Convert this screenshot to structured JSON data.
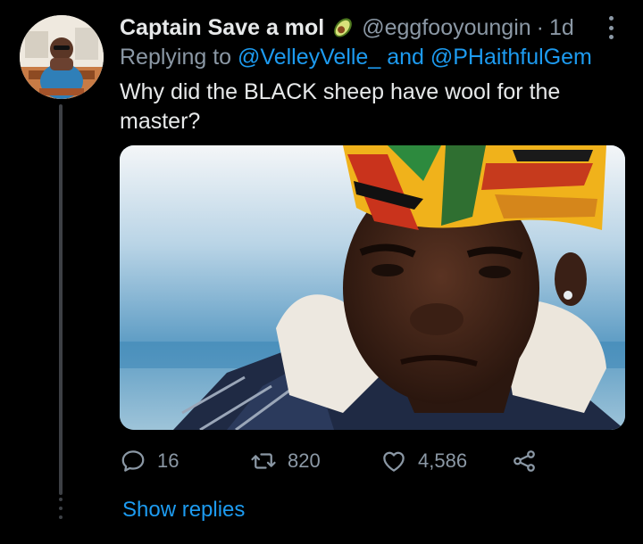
{
  "tweet": {
    "display_name": "Captain Save a mol",
    "name_emoji_icon": "avocado-icon",
    "handle": "@eggfooyoungin",
    "separator": "·",
    "time_ago": "1d",
    "replying_prefix": "Replying to",
    "replying_to_1": "@VelleyVelle_",
    "replying_and": "and",
    "replying_to_2": "@PHaithfulGem",
    "text": "Why did the BLACK sheep have wool for the master?"
  },
  "actions": {
    "reply_count": "16",
    "retweet_count": "820",
    "like_count": "4,586"
  },
  "show_replies_label": "Show replies",
  "icons": {
    "more": "more-vertical-icon",
    "reply": "reply-icon",
    "retweet": "retweet-icon",
    "like": "heart-icon",
    "share": "share-icon"
  },
  "colors": {
    "background": "#000000",
    "text_primary": "#e7e9ea",
    "text_secondary": "#8b98a5",
    "accent_link": "#1d9bf0",
    "thread_line": "#3d4045"
  }
}
